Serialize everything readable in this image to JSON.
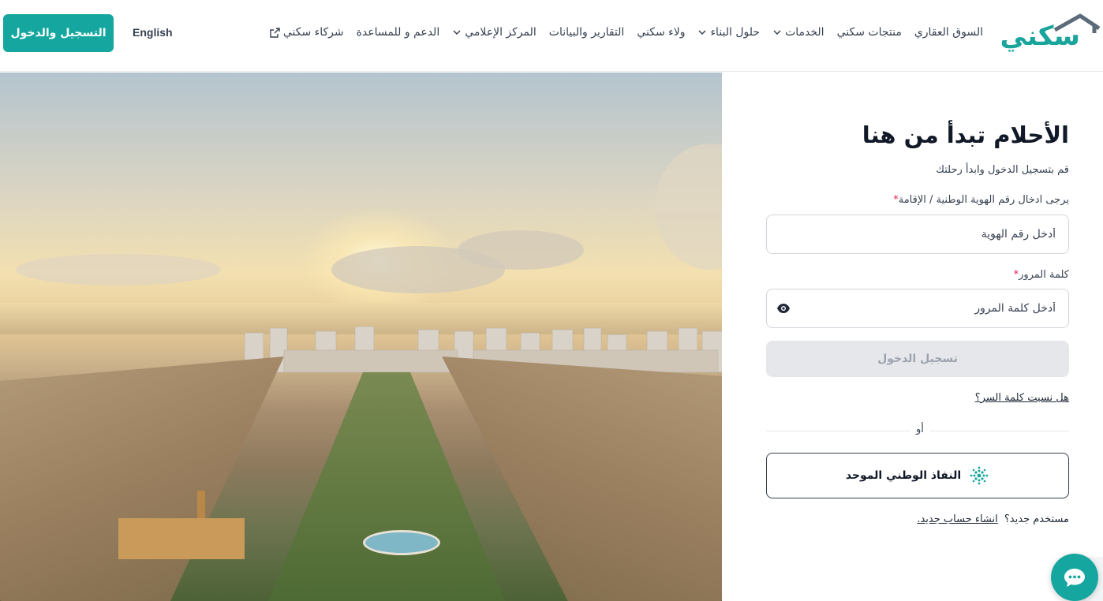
{
  "brand": {
    "logo_text": "سكني",
    "accent": "#15a79f",
    "roof_color": "#5b6b7a"
  },
  "nav": {
    "items": [
      {
        "label": "السوق العقاري",
        "dropdown": false
      },
      {
        "label": "منتجات سكني",
        "dropdown": false
      },
      {
        "label": "الخدمات",
        "dropdown": true
      },
      {
        "label": "حلول البناء",
        "dropdown": true
      },
      {
        "label": "ولاء سكني",
        "dropdown": false
      },
      {
        "label": "التقارير والبيانات",
        "dropdown": false
      },
      {
        "label": "المركز الإعلامي",
        "dropdown": true
      },
      {
        "label": "الدعم و للمساعدة",
        "dropdown": false
      },
      {
        "label": "شركاء سكني",
        "external": true
      }
    ],
    "language": "English",
    "cta": "التسجيل والدخول"
  },
  "login": {
    "title": "الأحلام تبدأ من هنا",
    "subtitle": "قم بتسجيل الدخول وابدأ رحلتك",
    "id_label": "يرجى ادخال رقم الهوية الوطنية / الإقامة",
    "id_placeholder": "أدخل رقم الهوية",
    "password_label": "كلمة المرور",
    "password_placeholder": "أدخل كلمة المرور",
    "required_mark": "*",
    "submit": "تسجيل الدخول",
    "forgot": "هل نسيت كلمة السر؟",
    "or": "أو",
    "nafath": "النفاذ الوطني الموحد",
    "new_user": "مستخدم جديد؟",
    "create_account": "انشاء حساب جديد."
  }
}
